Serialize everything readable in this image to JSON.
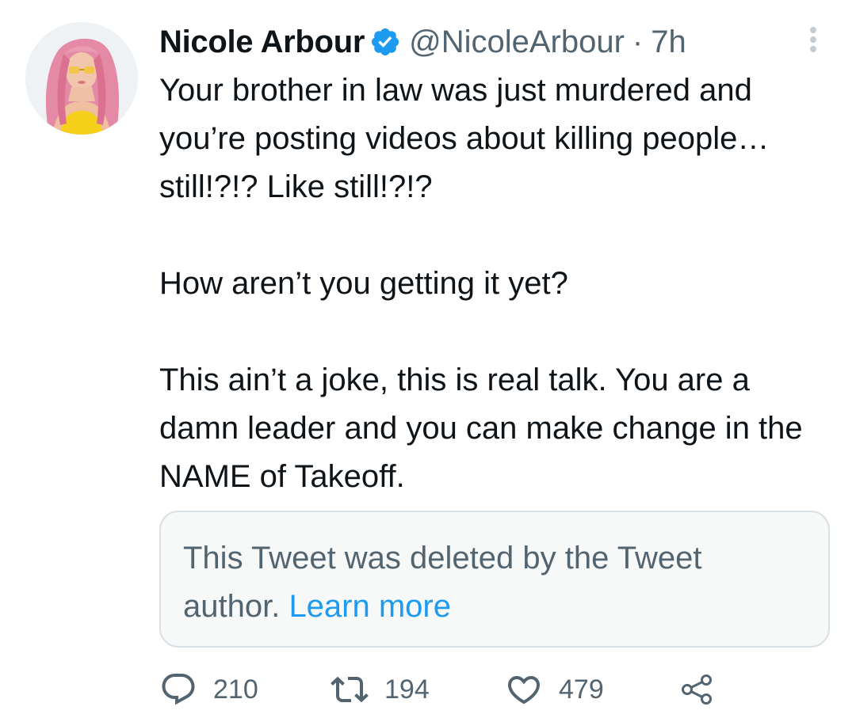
{
  "tweet": {
    "author": {
      "display_name": "Nicole Arbour",
      "handle": "@NicoleArbour",
      "separator": "·",
      "time": "7h",
      "verified_icon": "verified-badge-icon"
    },
    "text_paragraphs": [
      "Your brother in law was just murdered and you’re posting videos about killing people… still!?!? Like still!?!?",
      "How aren’t you getting it yet?",
      "This ain’t a joke, this is real talk. You are a damn leader and you can make change in the NAME of Takeoff."
    ],
    "quoted": {
      "message": "This Tweet was deleted by the Tweet author.",
      "link_label": "Learn more"
    },
    "actions": {
      "reply": {
        "icon": "reply-icon",
        "count": "210"
      },
      "retweet": {
        "icon": "retweet-icon",
        "count": "194"
      },
      "like": {
        "icon": "heart-icon",
        "count": "479"
      },
      "share": {
        "icon": "share-icon"
      }
    },
    "more_icon": "more-options-icon"
  },
  "colors": {
    "text_primary": "#0f1419",
    "text_secondary": "#536471",
    "accent_blue": "#1d9bf0",
    "quote_background": "#f7f9f9",
    "quote_border": "#d9e1e6"
  }
}
